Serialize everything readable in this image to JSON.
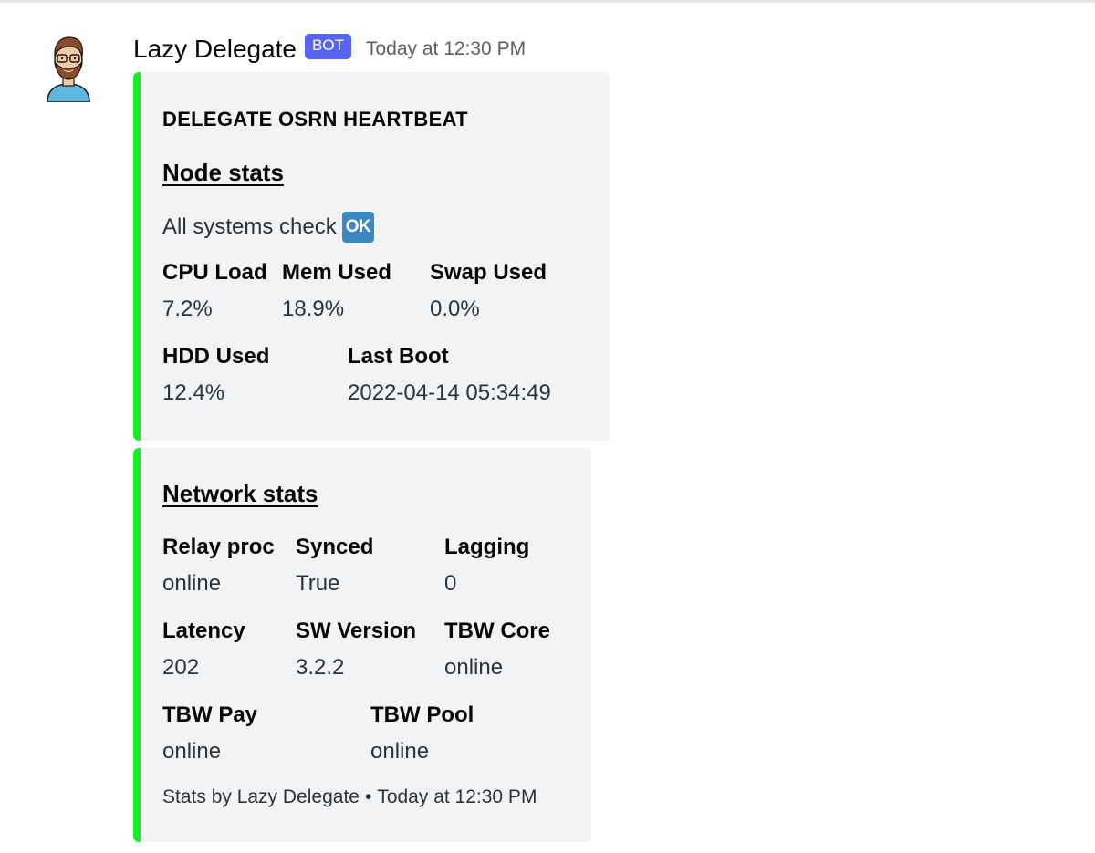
{
  "message": {
    "username": "Lazy Delegate",
    "bot_tag": "BOT",
    "timestamp": "Today at 12:30 PM",
    "avatar_icon": "bearded-man-avatar-icon"
  },
  "embed_color": "#1aed24",
  "embed1": {
    "author": "DELEGATE OSRN HEARTBEAT",
    "title": "Node stats",
    "description": "All systems check",
    "badge": "OK",
    "fields": [
      {
        "name": "CPU Load",
        "value": "7.2%"
      },
      {
        "name": "Mem Used",
        "value": "18.9%"
      },
      {
        "name": "Swap Used",
        "value": "0.0%"
      },
      {
        "name": "HDD Used",
        "value": "12.4%"
      },
      {
        "name": "Last Boot",
        "value": "2022-04-14 05:34:49"
      }
    ]
  },
  "embed2": {
    "title": "Network stats",
    "fields": [
      {
        "name": "Relay proc",
        "value": "online"
      },
      {
        "name": "Synced",
        "value": "True"
      },
      {
        "name": "Lagging",
        "value": "0"
      },
      {
        "name": "Latency",
        "value": "202"
      },
      {
        "name": "SW Version",
        "value": "3.2.2"
      },
      {
        "name": "TBW Core",
        "value": "online"
      },
      {
        "name": "TBW Pay",
        "value": "online"
      },
      {
        "name": "TBW Pool",
        "value": "online"
      }
    ],
    "footer": {
      "text": "Stats by Lazy Delegate",
      "separator": "•",
      "timestamp": "Today at 12:30 PM"
    }
  }
}
